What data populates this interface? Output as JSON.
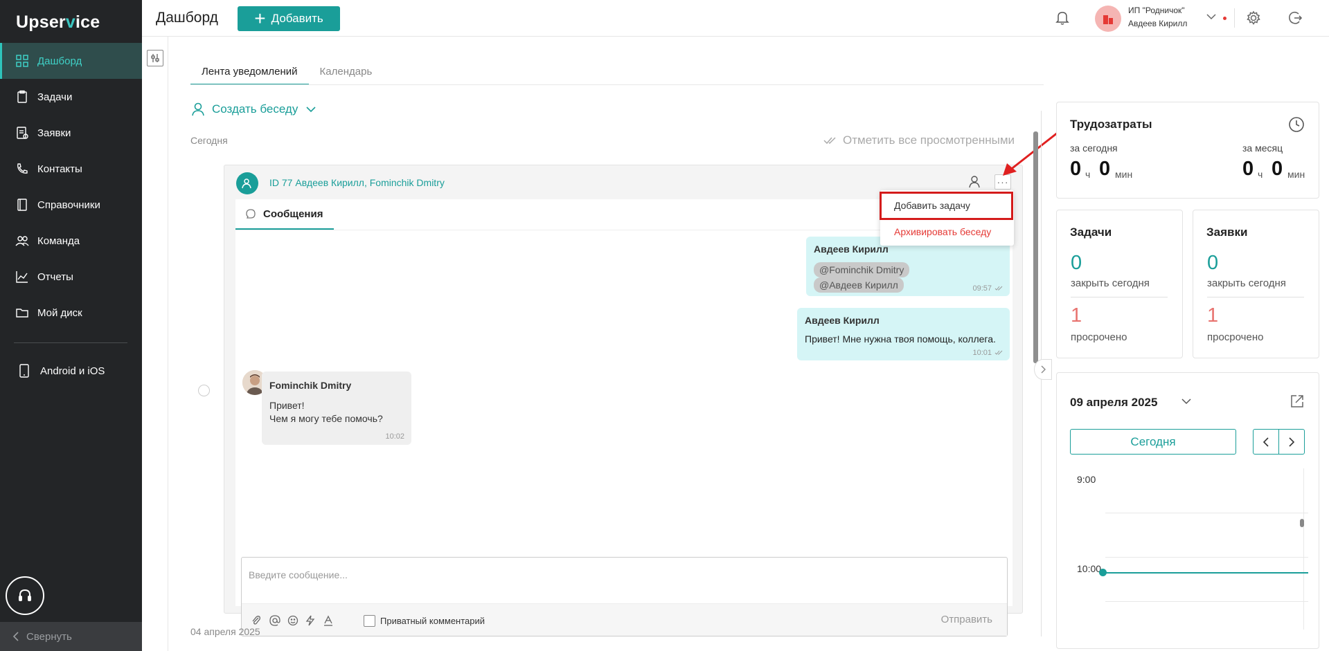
{
  "app": {
    "logo_pre": "Upser",
    "logo_v": "v",
    "logo_post": "ice"
  },
  "sidebar": {
    "items": [
      {
        "label": "Дашборд",
        "active": true
      },
      {
        "label": "Задачи"
      },
      {
        "label": "Заявки"
      },
      {
        "label": "Контакты"
      },
      {
        "label": "Справочники"
      },
      {
        "label": "Команда"
      },
      {
        "label": "Отчеты"
      },
      {
        "label": "Мой диск"
      }
    ],
    "mobile_label": "Android и iOS",
    "collapse_label": "Свернуть"
  },
  "header": {
    "title": "Дашборд",
    "add_label": "Добавить",
    "org_name": "ИП \"Родничок\"",
    "user_name": "Авдеев Кирилл"
  },
  "feed": {
    "tabs": [
      "Лента уведомлений",
      "Календарь"
    ],
    "create_conversation": "Создать беседу",
    "today": "Сегодня",
    "mark_all": "Отметить все просмотренными",
    "older_date": "04 апреля 2025"
  },
  "conversation": {
    "title": "ID 77 Авдеев Кирилл, Fominchik Dmitry",
    "messages_tab": "Сообщения",
    "menu": {
      "add_task": "Добавить задачу",
      "archive": "Архивировать беседу"
    },
    "messages": [
      {
        "author": "Авдеев Кирилл",
        "mentions": [
          "@Fominchik Dmitry",
          "@Авдеев Кирилл"
        ],
        "time": "09:57"
      },
      {
        "author": "Авдеев Кирилл",
        "text": "Привет! Мне нужна твоя помощь, коллега.",
        "time": "10:01"
      },
      {
        "author": "Fominchik Dmitry",
        "lines": [
          "Привет!",
          "Чем я могу тебе помочь?"
        ],
        "time": "10:02"
      }
    ],
    "composer": {
      "placeholder": "Введите сообщение...",
      "private_label": "Приватный комментарий",
      "send_label": "Отправить"
    }
  },
  "labor": {
    "title": "Трудозатраты",
    "today_label": "за сегодня",
    "month_label": "за месяц",
    "today_h": "0",
    "today_m": "0",
    "month_h": "0",
    "month_m": "0",
    "h_unit": "ч",
    "m_unit": "мин"
  },
  "tasks": {
    "title": "Задачи",
    "close_today": "0",
    "close_label": "закрыть сегодня",
    "overdue": "1",
    "overdue_label": "просрочено"
  },
  "requests": {
    "title": "Заявки",
    "close_today": "0",
    "close_label": "закрыть сегодня",
    "overdue": "1",
    "overdue_label": "просрочено"
  },
  "calendar": {
    "date": "09 апреля 2025",
    "today_btn": "Сегодня",
    "hours": [
      "9:00",
      "10:00"
    ]
  },
  "colors": {
    "accent": "#1a9e99",
    "sidebar": "#232527",
    "danger": "#e53935",
    "overdue": "#e8736f"
  }
}
